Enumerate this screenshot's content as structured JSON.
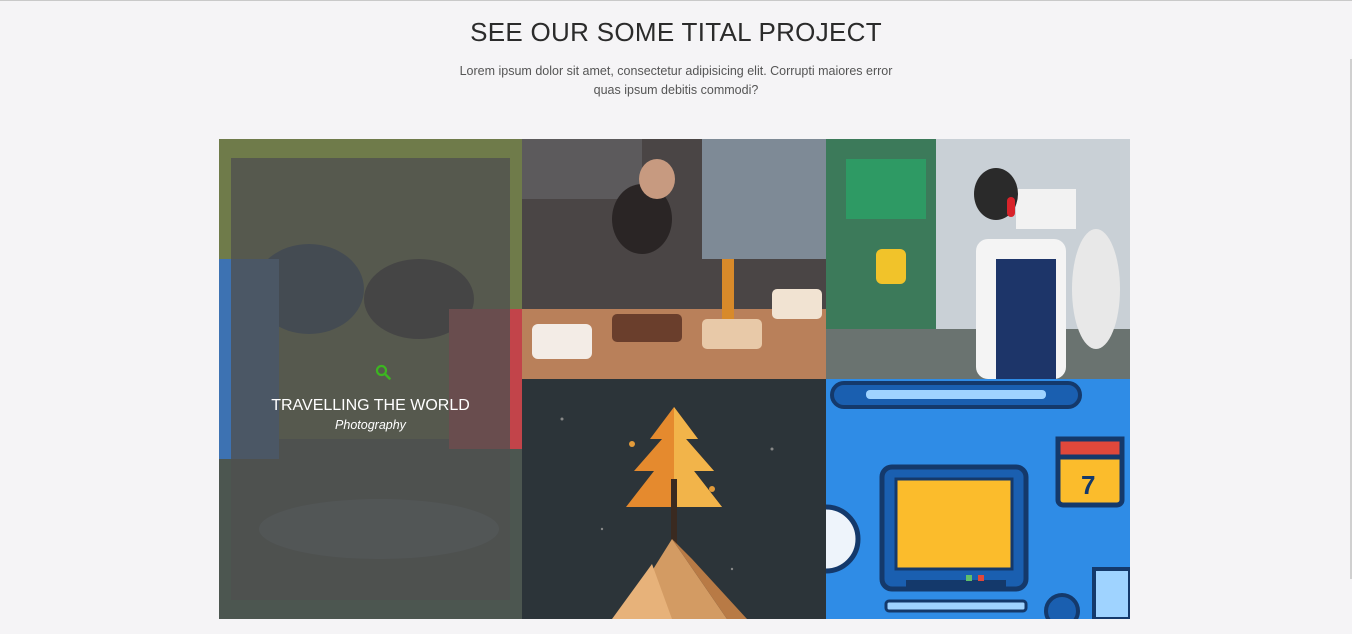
{
  "section": {
    "title": "SEE OUR SOME TITAL PROJECT",
    "subtitle": "Lorem ipsum dolor sit amet, consectetur adipisicing elit. Corrupti maiores error quas ipsum debitis commodi?"
  },
  "portfolio": {
    "items": [
      {
        "overlay_title": "TRAVELLING THE WORLD",
        "overlay_category": "Photography",
        "icon": "search-icon"
      },
      {
        "icon": "image"
      },
      {
        "icon": "image"
      },
      {
        "icon": "image"
      },
      {
        "icon": "image"
      }
    ]
  },
  "colors": {
    "accent": "#3cb521",
    "overlay": "#505050",
    "tile_blue": "#2f8ce6"
  }
}
